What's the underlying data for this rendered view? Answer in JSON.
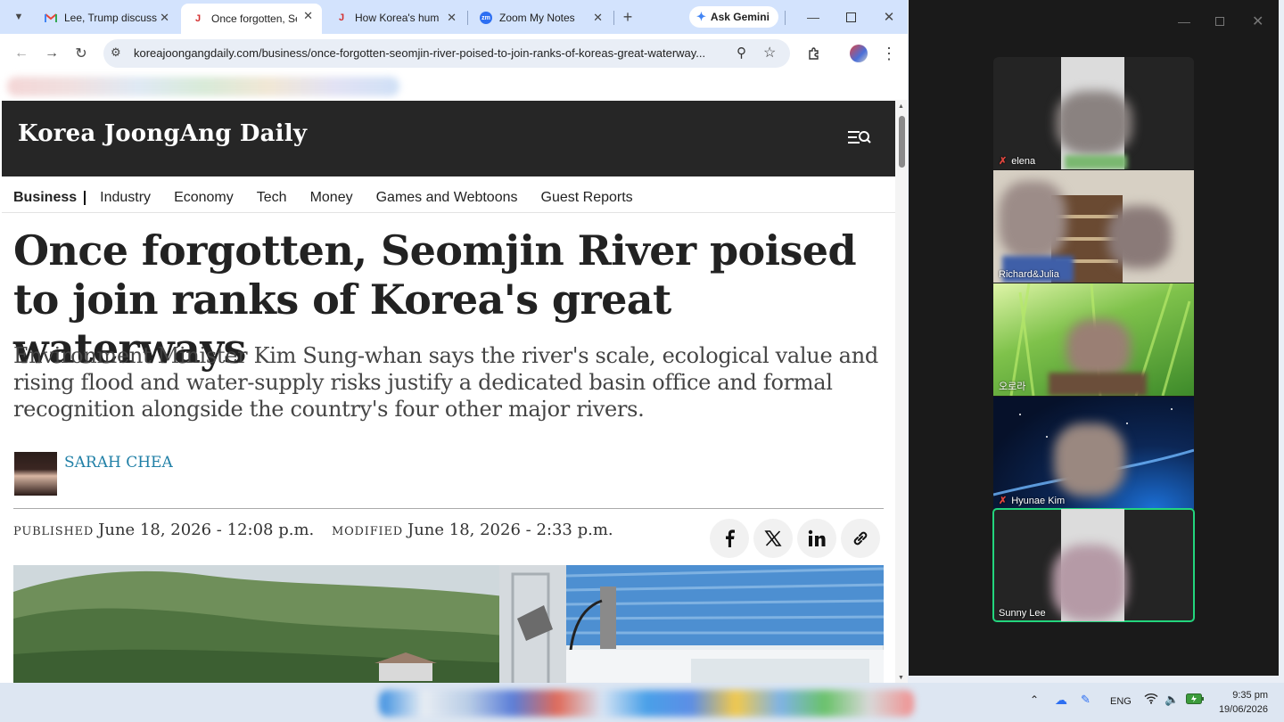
{
  "browser": {
    "tabs": [
      {
        "title": "Lee, Trump discuss",
        "favicon": "gmail-icon"
      },
      {
        "title": "Once forgotten, Se",
        "favicon": "jd-icon",
        "active": true
      },
      {
        "title": "How Korea's humb",
        "favicon": "jd-icon"
      },
      {
        "title": "Zoom My Notes",
        "favicon": "zoom-icon"
      }
    ],
    "gemini_label": "Ask Gemini",
    "url": "koreajoongangdaily.com/business/once-forgotten-seomjin-river-poised-to-join-ranks-of-koreas-great-waterway..."
  },
  "site": {
    "logo": "Korea JoongAng Daily",
    "section": "Business",
    "nav": [
      "Industry",
      "Economy",
      "Tech",
      "Money",
      "Games and Webtoons",
      "Guest Reports"
    ]
  },
  "article": {
    "headline": "Once forgotten, Seomjin River poised to join ranks of Korea's great waterways",
    "subhead": "Environment Minister Kim Sung-whan says the river's scale, ecological value and rising flood and water-supply risks justify a dedicated basin office and formal recognition alongside the country's four other major rivers.",
    "author": "SARAH CHEA",
    "published_label": "PUBLISHED",
    "published": "June 18, 2026 - 12:08 p.m.",
    "modified_label": "MODIFIED",
    "modified": "June 18, 2026 - 2:33 p.m."
  },
  "zoom": {
    "participants": [
      {
        "name": "elena",
        "muted": true
      },
      {
        "name": "Richard&Julia",
        "muted": false
      },
      {
        "name": "오로라",
        "muted": false
      },
      {
        "name": "Hyunae Kim",
        "muted": true
      },
      {
        "name": "Sunny Lee",
        "muted": false,
        "active_speaker": true
      }
    ]
  },
  "taskbar": {
    "language": "ENG",
    "time": "9:35 pm",
    "date": "19/06/2026"
  },
  "colors": {
    "tabstrip": "#d3e3fd",
    "masthead": "#262626",
    "author_link": "#1f7fa6",
    "active_speaker": "#23d57d",
    "muted": "#e0463e"
  }
}
